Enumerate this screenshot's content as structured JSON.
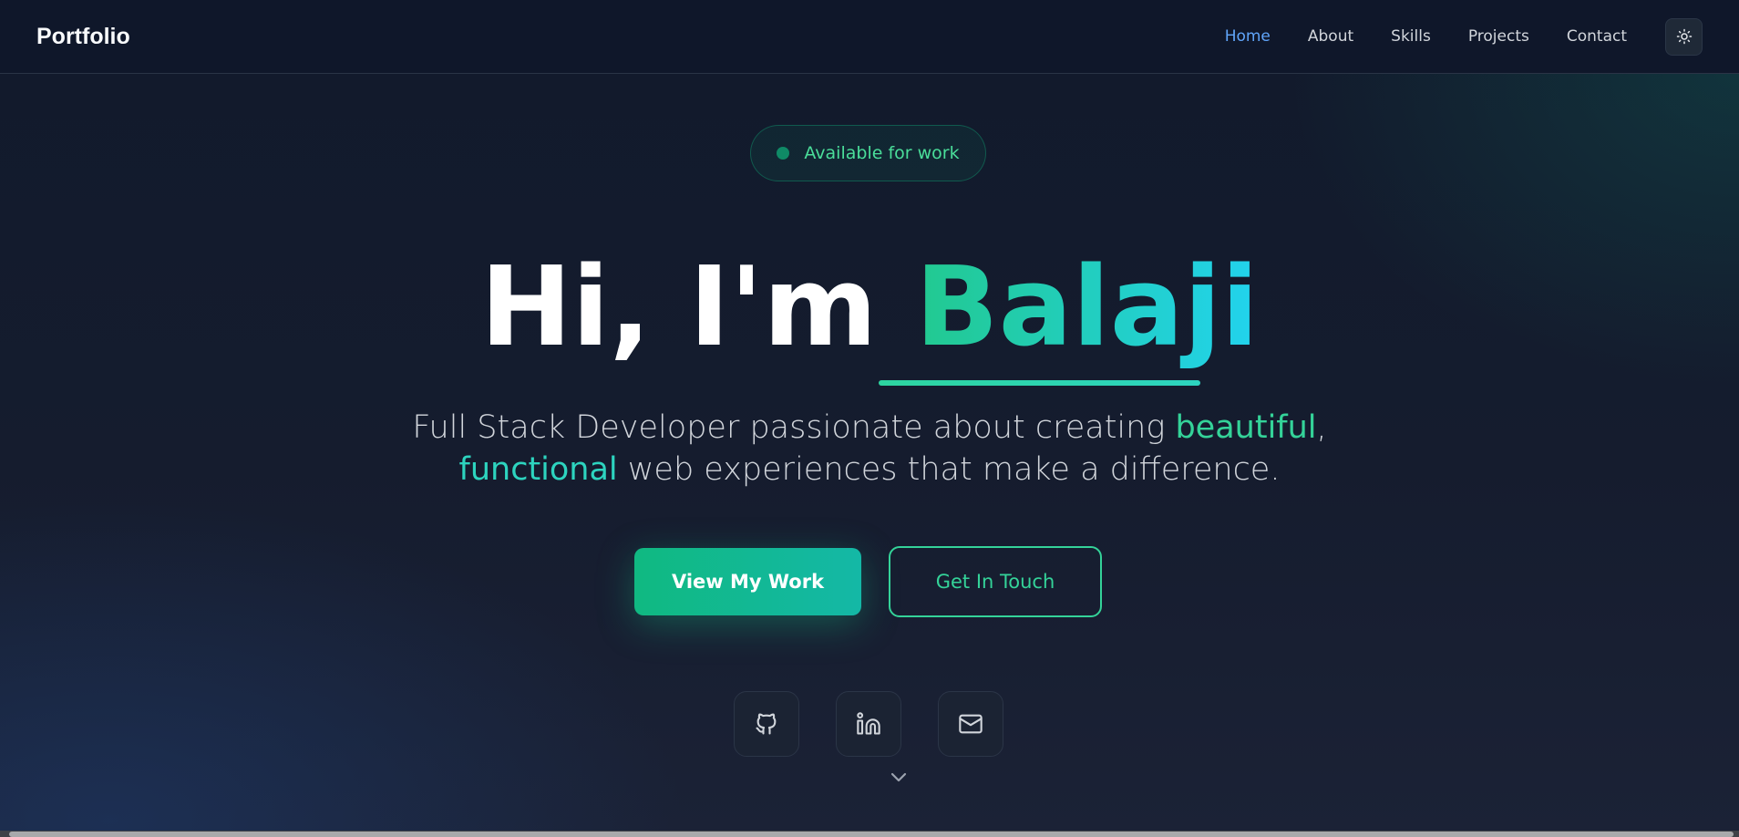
{
  "nav": {
    "logo": "Portfolio",
    "links": [
      "Home",
      "About",
      "Skills",
      "Projects",
      "Contact"
    ],
    "active": "Home",
    "theme_icon": "sun-icon"
  },
  "hero": {
    "badge": "Available for work",
    "greeting": "Hi, I'm ",
    "name": "Balaji",
    "subtitle_part1": "Full Stack Developer passionate about creating ",
    "subtitle_highlight1": "beautiful",
    "subtitle_part2": ",",
    "subtitle_highlight2": "functional",
    "subtitle_part3": " web experiences that make a difference.",
    "primary_button": "View My Work",
    "secondary_button": "Get In Touch"
  },
  "social": [
    {
      "icon": "github-icon"
    },
    {
      "icon": "linkedin-icon"
    },
    {
      "icon": "mail-icon"
    }
  ],
  "scroll_hint_icon": "chevron-down-icon",
  "colors": {
    "accent": "#34d399",
    "nav_active": "#60a5fa",
    "background": "#111827"
  }
}
